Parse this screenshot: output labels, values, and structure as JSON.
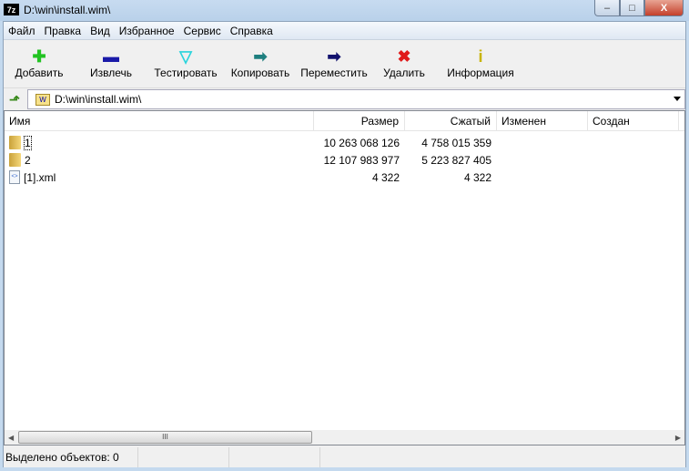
{
  "window": {
    "title": "D:\\win\\install.wim\\",
    "app_icon": "7z",
    "minimize": "–",
    "maximize": "□",
    "close": "X"
  },
  "menu": [
    "Файл",
    "Правка",
    "Вид",
    "Избранное",
    "Сервис",
    "Справка"
  ],
  "toolbar": [
    {
      "label": "Добавить",
      "icon": "plus-icon",
      "glyph": "✚",
      "color": "#22c322"
    },
    {
      "label": "Извлечь",
      "icon": "minus-icon",
      "glyph": "▬",
      "color": "#1a1aa8"
    },
    {
      "label": "Тестировать",
      "icon": "check-icon",
      "glyph": "▽",
      "color": "#2ad4dc"
    },
    {
      "label": "Копировать",
      "icon": "copy-arrow-icon",
      "glyph": "➡",
      "color": "#1e7f7f"
    },
    {
      "label": "Переместить",
      "icon": "move-arrow-icon",
      "glyph": "➡",
      "color": "#12126e"
    },
    {
      "label": "Удалить",
      "icon": "delete-icon",
      "glyph": "✖",
      "color": "#e01a1a"
    },
    {
      "label": "Информация",
      "icon": "info-icon",
      "glyph": "i",
      "color": "#c8b400"
    }
  ],
  "address": {
    "path": "D:\\win\\install.wim\\",
    "up_glyph": "⬏"
  },
  "columns": [
    "Имя",
    "Размер",
    "Сжатый",
    "Изменен",
    "Создан"
  ],
  "rows": [
    {
      "name": "1",
      "type": "folder",
      "size": "10 263 068 126",
      "packed": "4 758 015 359"
    },
    {
      "name": "2",
      "type": "folder",
      "size": "12 107 983 977",
      "packed": "5 223 827 405"
    },
    {
      "name": "[1].xml",
      "type": "xml",
      "size": "4 322",
      "packed": "4 322"
    }
  ],
  "scroll": {
    "left": "◀",
    "right": "▶",
    "grip": "III"
  },
  "status": {
    "selected": "Выделено объектов: 0"
  }
}
